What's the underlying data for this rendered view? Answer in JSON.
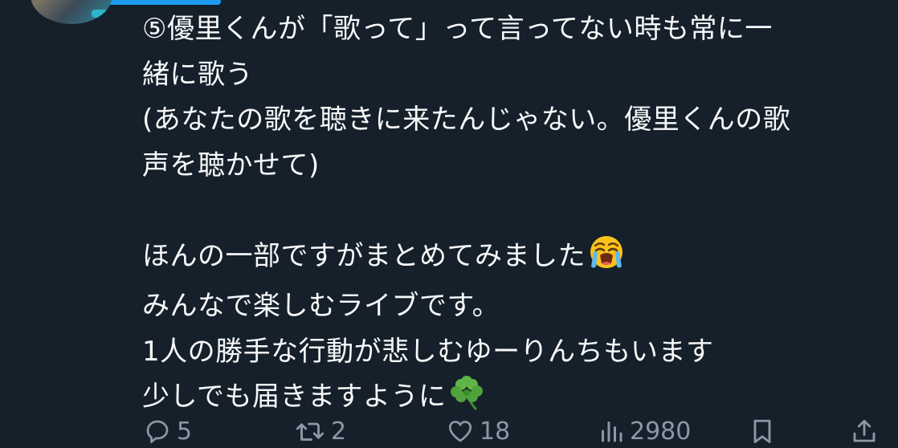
{
  "tweet": {
    "lines": [
      "⑤優里くんが「歌って」って言ってない時も常に一",
      "緒に歌う",
      "(あなたの歌を聴きに来たんじゃない。優里くんの歌",
      "声を聴かせて)",
      "",
      "ほんの一部ですがまとめてみました",
      "みんなで楽しむライブです。",
      "1人の勝手な行動が悲しむゆーりんちもいます",
      "少しでも届きますように"
    ],
    "emojis": {
      "crying": "loudly-crying-face-emoji",
      "clover": "shamrock-emoji"
    }
  },
  "actions": {
    "reply": {
      "icon": "reply-icon",
      "count": "5"
    },
    "retweet": {
      "icon": "retweet-icon",
      "count": "2"
    },
    "like": {
      "icon": "heart-icon",
      "count": "18"
    },
    "views": {
      "icon": "views-icon",
      "count": "2980"
    },
    "bookmark": {
      "icon": "bookmark-icon"
    },
    "share": {
      "icon": "share-icon"
    }
  },
  "colors": {
    "background": "#15202b",
    "text": "#f7f9f9",
    "muted": "#8b98a5",
    "accent": "#1d9bf0"
  }
}
